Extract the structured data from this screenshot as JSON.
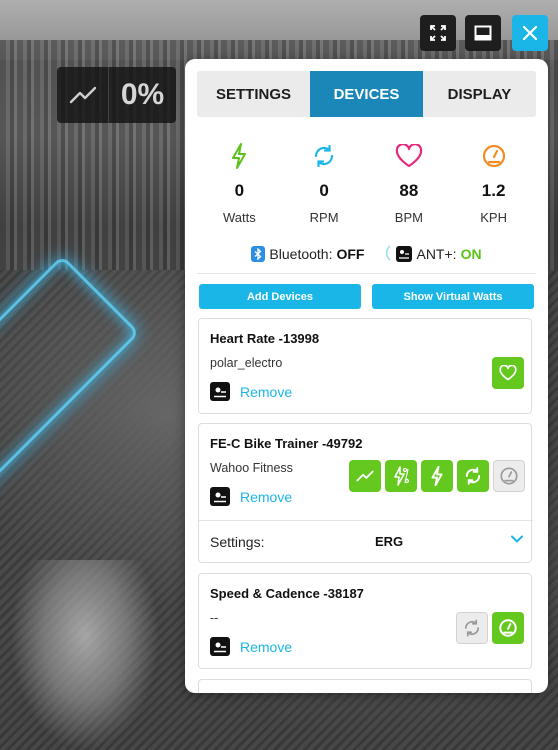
{
  "overlay": {
    "power_percent": "0%"
  },
  "tabs": [
    {
      "label": "SETTINGS",
      "active": false
    },
    {
      "label": "DEVICES",
      "active": true
    },
    {
      "label": "DISPLAY",
      "active": false
    }
  ],
  "metrics": [
    {
      "icon": "lightning-icon",
      "value": "0",
      "unit": "Watts",
      "color": "#5cc21a"
    },
    {
      "icon": "cadence-refresh-icon",
      "value": "0",
      "unit": "RPM",
      "color": "#1bb6e8"
    },
    {
      "icon": "heart-icon",
      "value": "88",
      "unit": "BPM",
      "color": "#e8287c"
    },
    {
      "icon": "speedometer-icon",
      "value": "1.2",
      "unit": "KPH",
      "color": "#f28c22"
    }
  ],
  "connections": {
    "bluetooth_label": "Bluetooth:",
    "bluetooth_status": "OFF",
    "ant_label": "ANT+:",
    "ant_status": "ON"
  },
  "actions": {
    "add_devices": "Add Devices",
    "show_virtual_watts": "Show Virtual Watts"
  },
  "devices": [
    {
      "name": "Heart Rate -13998",
      "manufacturer": "polar_electro",
      "remove_label": "Remove",
      "capabilities": [
        {
          "icon": "heart-icon",
          "active": true
        }
      ]
    },
    {
      "name": "FE-C Bike Trainer -49792",
      "manufacturer": "Wahoo Fitness",
      "remove_label": "Remove",
      "capabilities": [
        {
          "icon": "trend-line-icon",
          "active": true
        },
        {
          "icon": "lightning-percent-icon",
          "active": true
        },
        {
          "icon": "lightning-icon",
          "active": true
        },
        {
          "icon": "cadence-refresh-icon",
          "active": true
        },
        {
          "icon": "speedometer-icon",
          "active": false
        }
      ],
      "settings_label": "Settings:",
      "settings_value": "ERG"
    },
    {
      "name": "Speed & Cadence -38187",
      "manufacturer": "--",
      "remove_label": "Remove",
      "capabilities": [
        {
          "icon": "cadence-refresh-icon",
          "active": false
        },
        {
          "icon": "speedometer-icon",
          "active": true
        }
      ]
    }
  ],
  "colors": {
    "accent": "#1bb6e8",
    "tab_active": "#1a87b8",
    "active_chip": "#64c81e"
  }
}
